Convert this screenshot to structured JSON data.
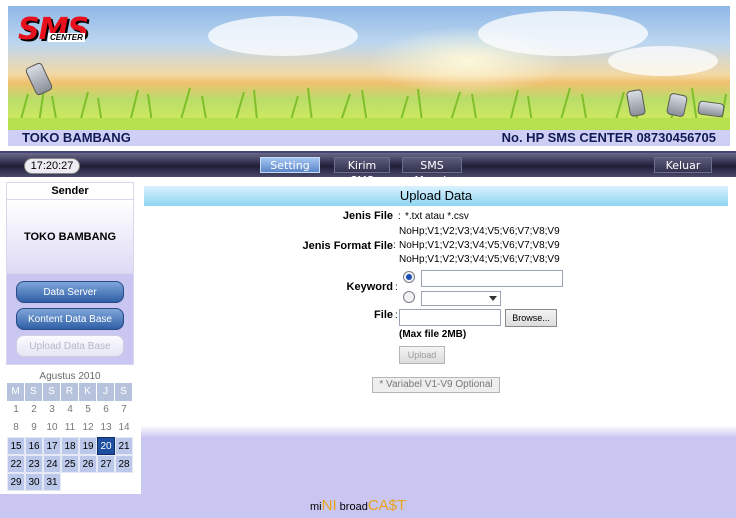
{
  "header": {
    "logo_text": "SMS",
    "logo_sub": "CENTER",
    "store_name": "TOKO BAMBANG",
    "hp_label": "No. HP SMS CENTER 08730456705"
  },
  "nav": {
    "clock": "17:20:27",
    "items": [
      {
        "label": "Setting"
      },
      {
        "label": "Kirim SMS"
      },
      {
        "label": "SMS Masuk"
      },
      {
        "label": "Keluar"
      }
    ]
  },
  "sidebar": {
    "sender_label": "Sender",
    "sender_name": "TOKO BAMBANG",
    "menu": [
      {
        "label": "Data Server"
      },
      {
        "label": "Kontent Data Base"
      },
      {
        "label": "Upload Data Base"
      }
    ]
  },
  "calendar": {
    "title": "Agustus 2010",
    "weekdays": [
      "M",
      "S",
      "S",
      "R",
      "K",
      "J",
      "S"
    ],
    "rows": [
      [
        "1",
        "2",
        "3",
        "4",
        "5",
        "6",
        "7"
      ],
      [
        "8",
        "9",
        "10",
        "11",
        "12",
        "13",
        "14"
      ],
      [
        "15",
        "16",
        "17",
        "18",
        "19",
        "20",
        "21"
      ],
      [
        "22",
        "23",
        "24",
        "25",
        "26",
        "27",
        "28"
      ],
      [
        "29",
        "30",
        "31",
        "",
        "",
        "",
        ""
      ]
    ],
    "today": "20"
  },
  "upload": {
    "title": "Upload Data",
    "jenis_file_label": "Jenis File",
    "jenis_file_value": "*.txt atau *.csv",
    "jenis_format_label": "Jenis Format File",
    "formats": [
      "NoHp;V1;V2;V3;V4;V5;V6;V7;V8;V9",
      "NoHp;V1;V2;V3;V4;V5;V6;V7;V8;V9",
      "NoHp;V1;V2;V3;V4;V5;V6;V7;V8;V9"
    ],
    "keyword_label": "Keyword",
    "file_label": "File",
    "browse_label": "Browse...",
    "max_note": "(Max file 2MB)",
    "upload_button": "Upload",
    "variable_note": "* Variabel V1-V9 Optional",
    "colon": ":"
  },
  "footer": {
    "brand_mi": "mi",
    "brand_ni": "NI",
    "brand_broad": "broad",
    "brand_cast": "CA$T"
  }
}
